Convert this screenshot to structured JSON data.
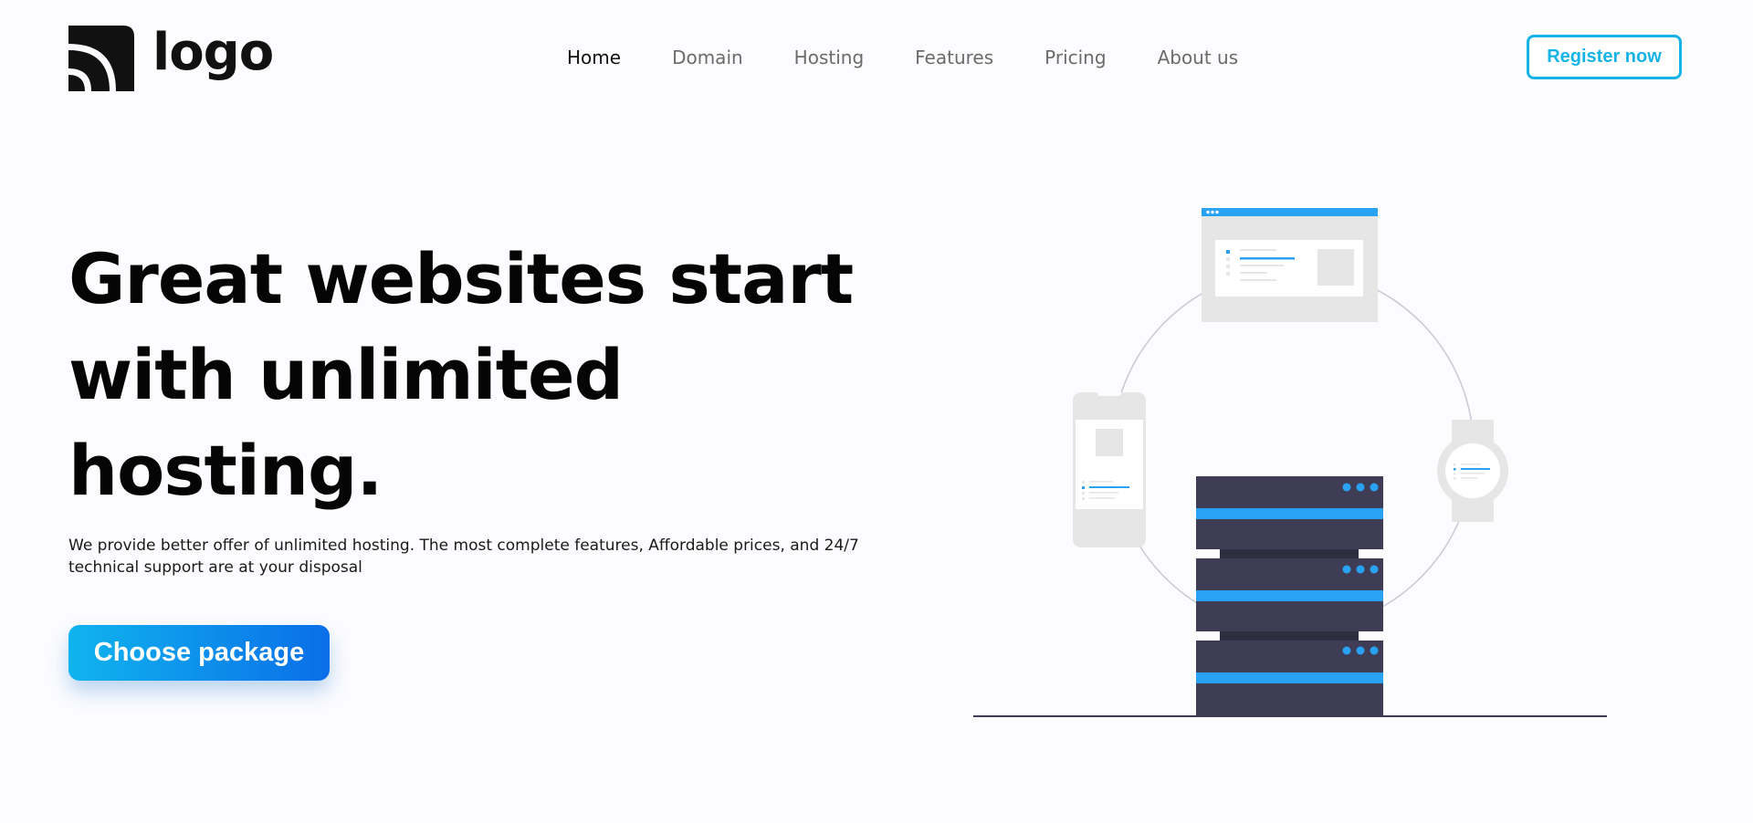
{
  "header": {
    "logo_text": "logo",
    "nav": [
      {
        "label": "Home",
        "active": true
      },
      {
        "label": "Domain",
        "active": false
      },
      {
        "label": "Hosting",
        "active": false
      },
      {
        "label": "Features",
        "active": false
      },
      {
        "label": "Pricing",
        "active": false
      },
      {
        "label": "About us",
        "active": false
      }
    ],
    "register_label": "Register now"
  },
  "hero": {
    "title_lines": [
      "Great websites start",
      "with unlimited",
      "hosting."
    ],
    "description_lines": [
      "We provide better offer of unlimited hosting. The most complete features, Affordable prices, and 24/7",
      "technical support are at your disposal"
    ],
    "cta_label": "Choose package"
  },
  "colors": {
    "accent": "#16b3e6",
    "cta_gradient_start": "#10b4ee",
    "cta_gradient_end": "#0a6ee8",
    "server_dark": "#3f3d56",
    "server_stripe": "#2aa2f4",
    "device_gray": "#e6e6e6"
  },
  "icons": {
    "logo_mark": "wifi-arcs-icon",
    "server": "server-rack-illustration",
    "browser": "browser-window-illustration",
    "phone": "smartphone-illustration",
    "watch": "smartwatch-illustration"
  }
}
